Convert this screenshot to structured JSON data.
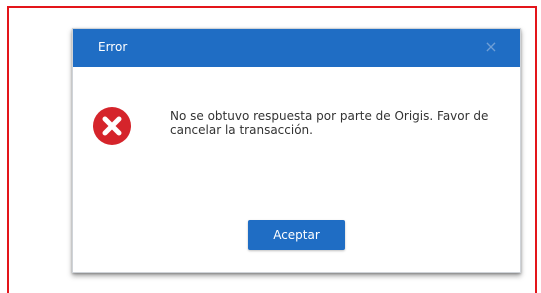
{
  "dialog": {
    "title": "Error",
    "close_glyph": "×",
    "message": "No se obtuvo respuesta por parte de Origis. Favor de cancelar la transacción.",
    "ok_label": "Aceptar",
    "icon": "error-x-circle-icon"
  },
  "colors": {
    "header": "#1f6dc4",
    "button": "#1f6dc4",
    "error_icon": "#d5242b",
    "frame_border": "#e3151a"
  }
}
